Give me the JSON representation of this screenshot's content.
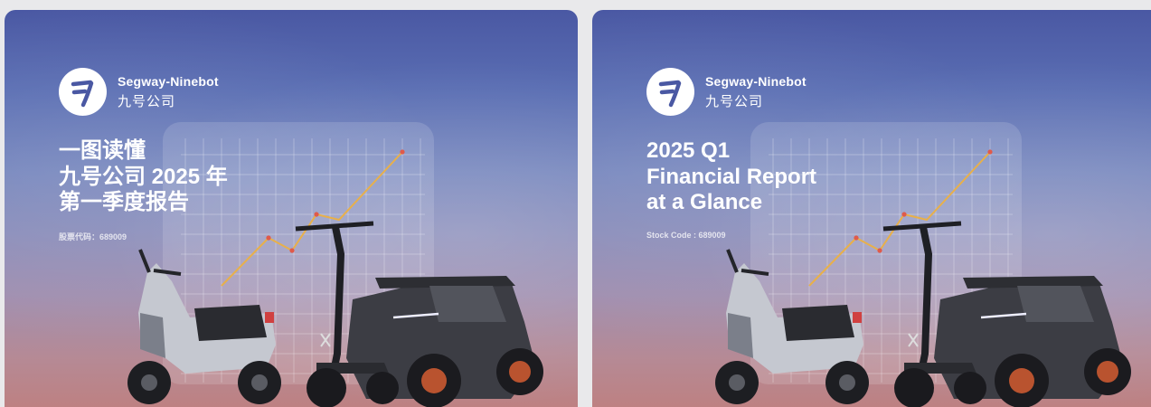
{
  "brand": {
    "name_en": "Segway-Ninebot",
    "name_cn": "九号公司"
  },
  "cards": [
    {
      "lang": "zh",
      "title_lines": [
        "一图读懂",
        "九号公司 2025 年",
        "第一季度报告"
      ],
      "stock_code": "股票代码：689009"
    },
    {
      "lang": "en",
      "title_lines": [
        "2025 Q1",
        "Financial Report",
        "at a Glance"
      ],
      "stock_code": "Stock Code : 689009"
    }
  ],
  "icons": [
    "segway-ninebot-logo-icon",
    "growth-line-chart-icon",
    "electric-scooter-moped-icon",
    "kick-scooter-icon",
    "utv-vehicle-icon"
  ],
  "colors": {
    "sky_top": "#4a58a3",
    "sky_bottom": "#bf7f7e",
    "chart_line": "#e8b04a",
    "chart_point": "#e05a4a"
  }
}
